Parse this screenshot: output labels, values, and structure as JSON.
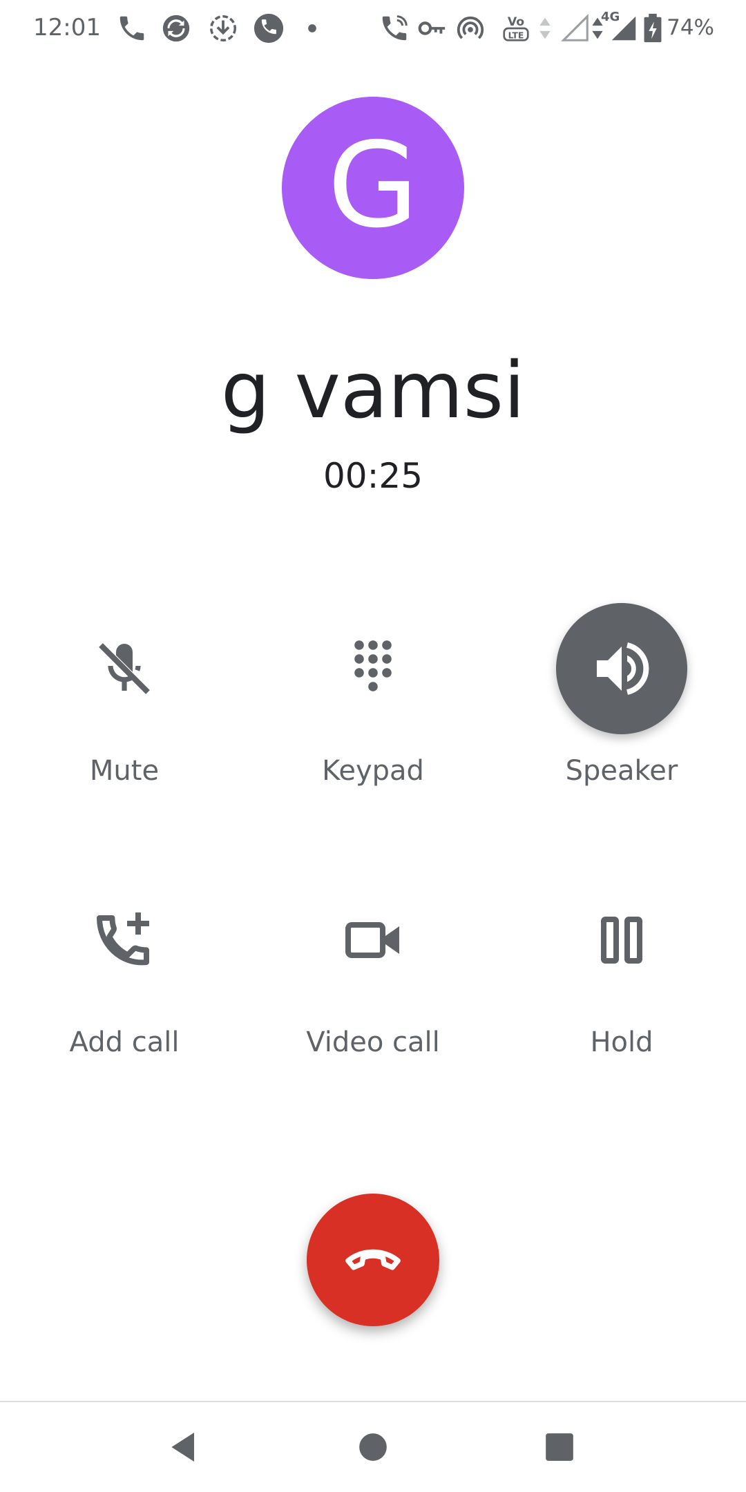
{
  "status_bar": {
    "time": "12:01",
    "network_type": "4G",
    "battery_percent": "74%",
    "icons": [
      "phone-icon",
      "app-sync-icon",
      "download-icon",
      "whatsapp-call-icon",
      "dot-icon",
      "wifi-calling-icon",
      "vpn-key-icon",
      "hotspot-icon",
      "volte-icon",
      "data-arrows-icon",
      "signal-empty-icon",
      "signal-full-icon",
      "battery-charging-icon"
    ]
  },
  "contact": {
    "avatar_letter": "G",
    "avatar_color": "#a95cf5",
    "name": "g vamsi",
    "call_duration": "00:25"
  },
  "controls": {
    "mute": {
      "label": "Mute",
      "icon": "mic-off-icon",
      "active": false
    },
    "keypad": {
      "label": "Keypad",
      "icon": "dialpad-icon",
      "active": false
    },
    "speaker": {
      "label": "Speaker",
      "icon": "speaker-icon",
      "active": true
    },
    "add_call": {
      "label": "Add call",
      "icon": "add-call-icon",
      "active": false
    },
    "video_call": {
      "label": "Video call",
      "icon": "video-camera-icon",
      "active": false
    },
    "hold": {
      "label": "Hold",
      "icon": "pause-icon",
      "active": false
    }
  },
  "end_call": {
    "icon": "call-end-icon",
    "color": "#d93025"
  },
  "nav": {
    "back": "back-icon",
    "home": "home-icon",
    "recents": "recents-icon"
  }
}
